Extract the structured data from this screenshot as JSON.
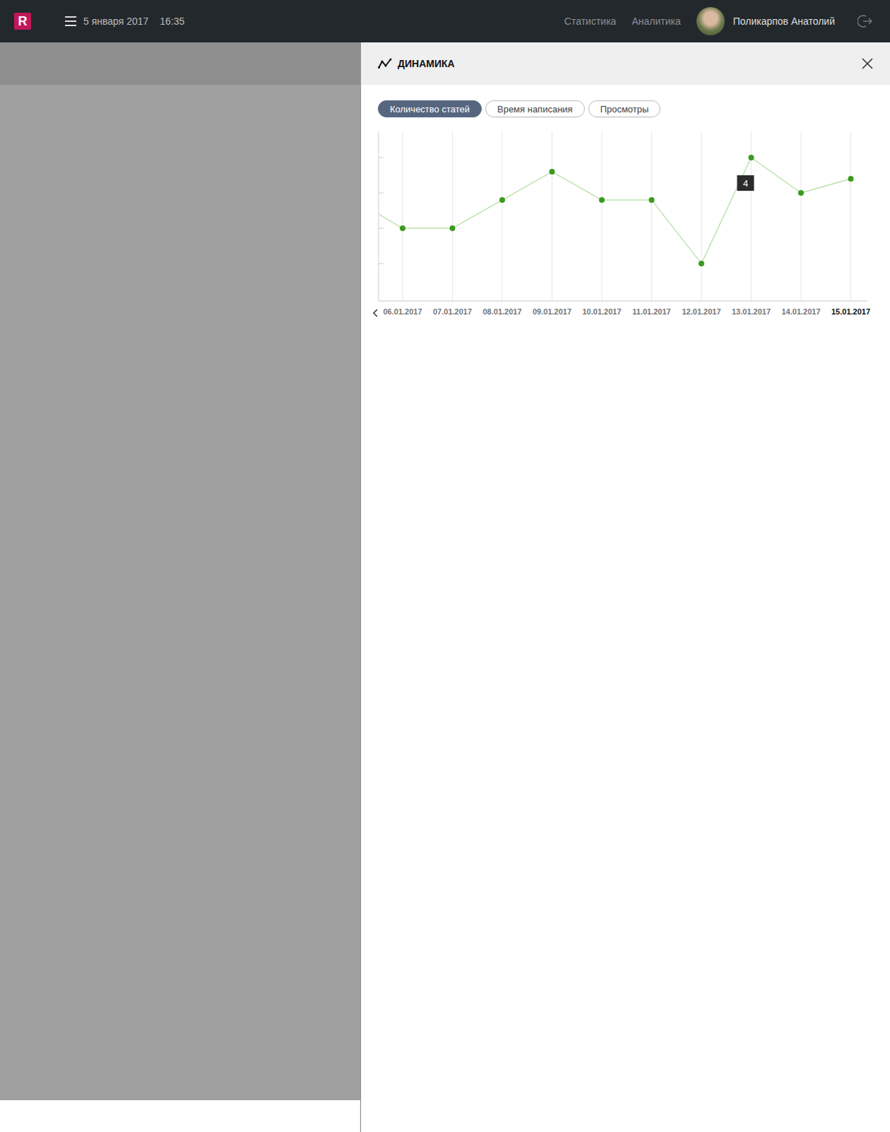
{
  "logo": "R",
  "header": {
    "date": "5 января 2017",
    "time": "16:35",
    "nav": [
      {
        "label": "Статистика"
      },
      {
        "label": "Аналитика"
      }
    ],
    "user": "Поликарпов Анатолий"
  },
  "panel": {
    "title": "ДИНАМИКА"
  },
  "tabs": [
    {
      "label": "Количество статей",
      "selected": true
    },
    {
      "label": "Время написания",
      "selected": false
    },
    {
      "label": "Просмотры",
      "selected": false
    }
  ],
  "chart": {
    "dates": [
      {
        "label": "06.01.2017",
        "selected": false
      },
      {
        "label": "07.01.2017",
        "selected": false
      },
      {
        "label": "08.01.2017",
        "selected": false
      },
      {
        "label": "09.01.2017",
        "selected": false
      },
      {
        "label": "10.01.2017",
        "selected": false
      },
      {
        "label": "11.01.2017",
        "selected": false
      },
      {
        "label": "12.01.2017",
        "selected": false
      },
      {
        "label": "13.01.2017",
        "selected": false
      },
      {
        "label": "14.01.2017",
        "selected": false
      },
      {
        "label": "15.01.2017",
        "selected": true
      }
    ],
    "values": [
      2,
      2,
      2.8,
      3.6,
      2.8,
      2.8,
      1,
      4,
      3,
      3.4
    ],
    "entry_value": 2.4,
    "tooltip": {
      "index": 7,
      "text": "4"
    }
  }
}
